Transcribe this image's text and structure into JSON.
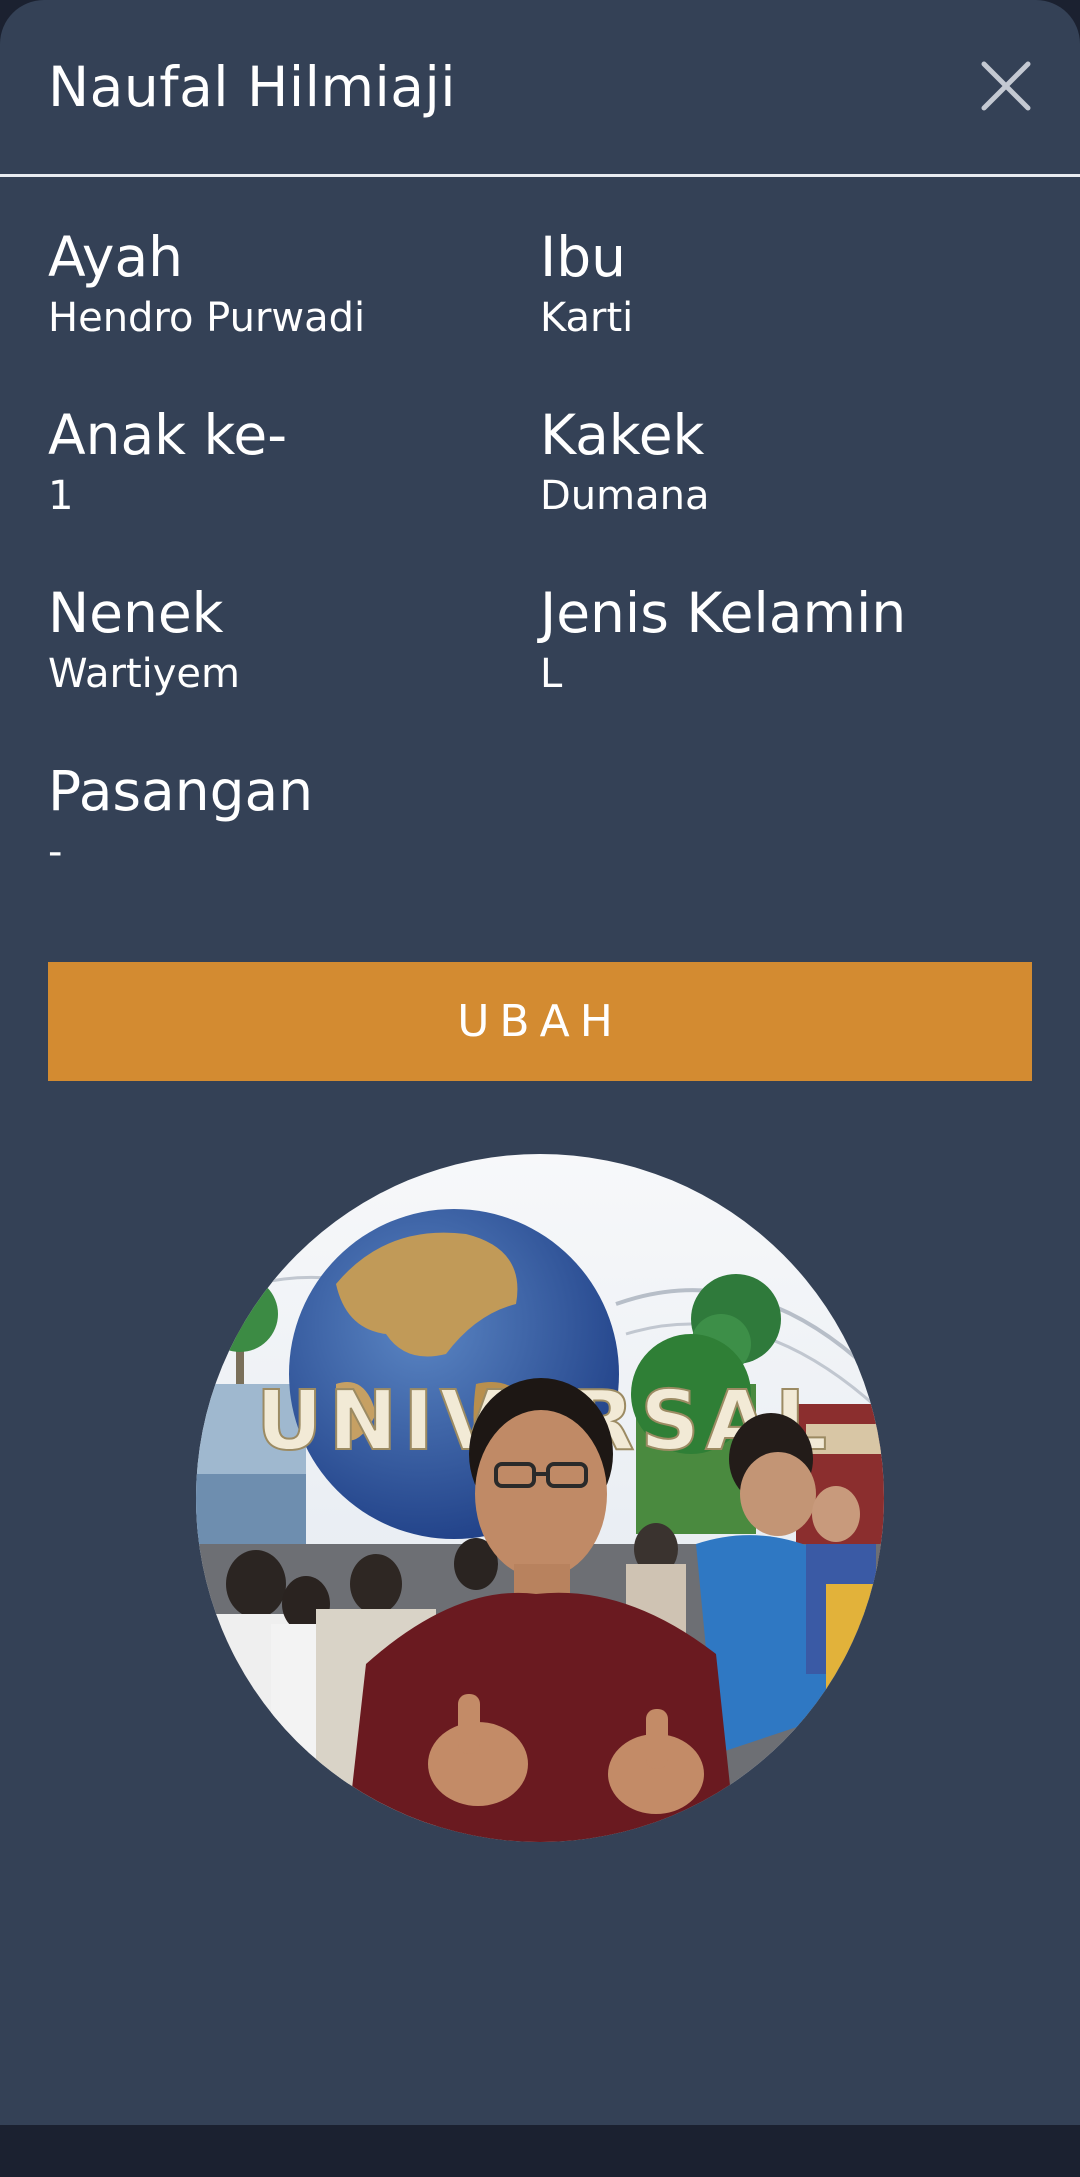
{
  "header": {
    "title": "Naufal Hilmiaji",
    "close_icon": "close-icon"
  },
  "fields": {
    "ayah": {
      "label": "Ayah",
      "value": "Hendro Purwadi"
    },
    "ibu": {
      "label": "Ibu",
      "value": "Karti"
    },
    "anak_ke": {
      "label": "Anak ke-",
      "value": "1"
    },
    "kakek": {
      "label": "Kakek",
      "value": "Dumana"
    },
    "nenek": {
      "label": "Nenek",
      "value": "Wartiyem"
    },
    "jenis_kelamin": {
      "label": "Jenis Kelamin",
      "value": "L"
    },
    "pasangan": {
      "label": "Pasangan",
      "value": "-"
    }
  },
  "actions": {
    "edit_label": "UBAH"
  },
  "colors": {
    "background": "#344156",
    "accent": "#d38b31",
    "text": "#ffffff"
  },
  "photo": {
    "globe_text": "UNIVERSAL"
  }
}
